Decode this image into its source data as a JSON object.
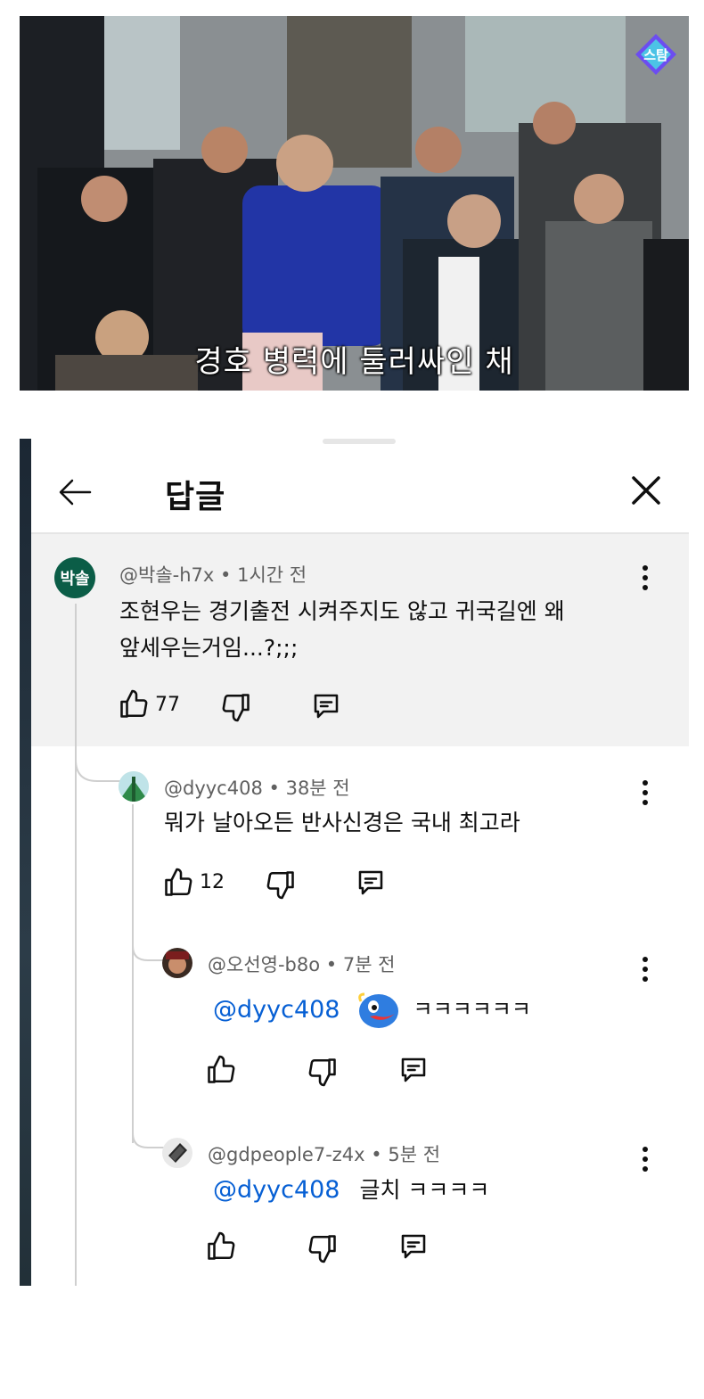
{
  "video": {
    "subtitle": "경호 병력에 둘러싸인 채",
    "channel_logo_text": "스탐"
  },
  "header": {
    "title": "답글"
  },
  "comments": [
    {
      "author": "@박솔-h7x",
      "time": "1시간 전",
      "avatar_text": "박솔",
      "text_line1": "조현우는 경기출전 시켜주지도 않고 귀국길엔 왜",
      "text_line2": "앞세우는거임...?;;;",
      "likes": "77"
    },
    {
      "author": "@dyyc408",
      "time": "38분 전",
      "text_line1": "뭐가 날아오든 반사신경은 국내 최고라",
      "likes": "12"
    },
    {
      "author": "@오선영-b8o",
      "time": "7분 전",
      "mention": "@dyyc408",
      "text_after": "ㅋㅋㅋㅋㅋㅋ"
    },
    {
      "author": "@gdpeople7-z4x",
      "time": "5분 전",
      "mention": "@dyyc408",
      "text_after": "글치 ㅋㅋㅋㅋ"
    }
  ],
  "separator": " • ",
  "colors": {
    "mention": "#065fd4",
    "highlight_bg": "#f2f2f2",
    "avatar_bg": "#0b5d47"
  }
}
